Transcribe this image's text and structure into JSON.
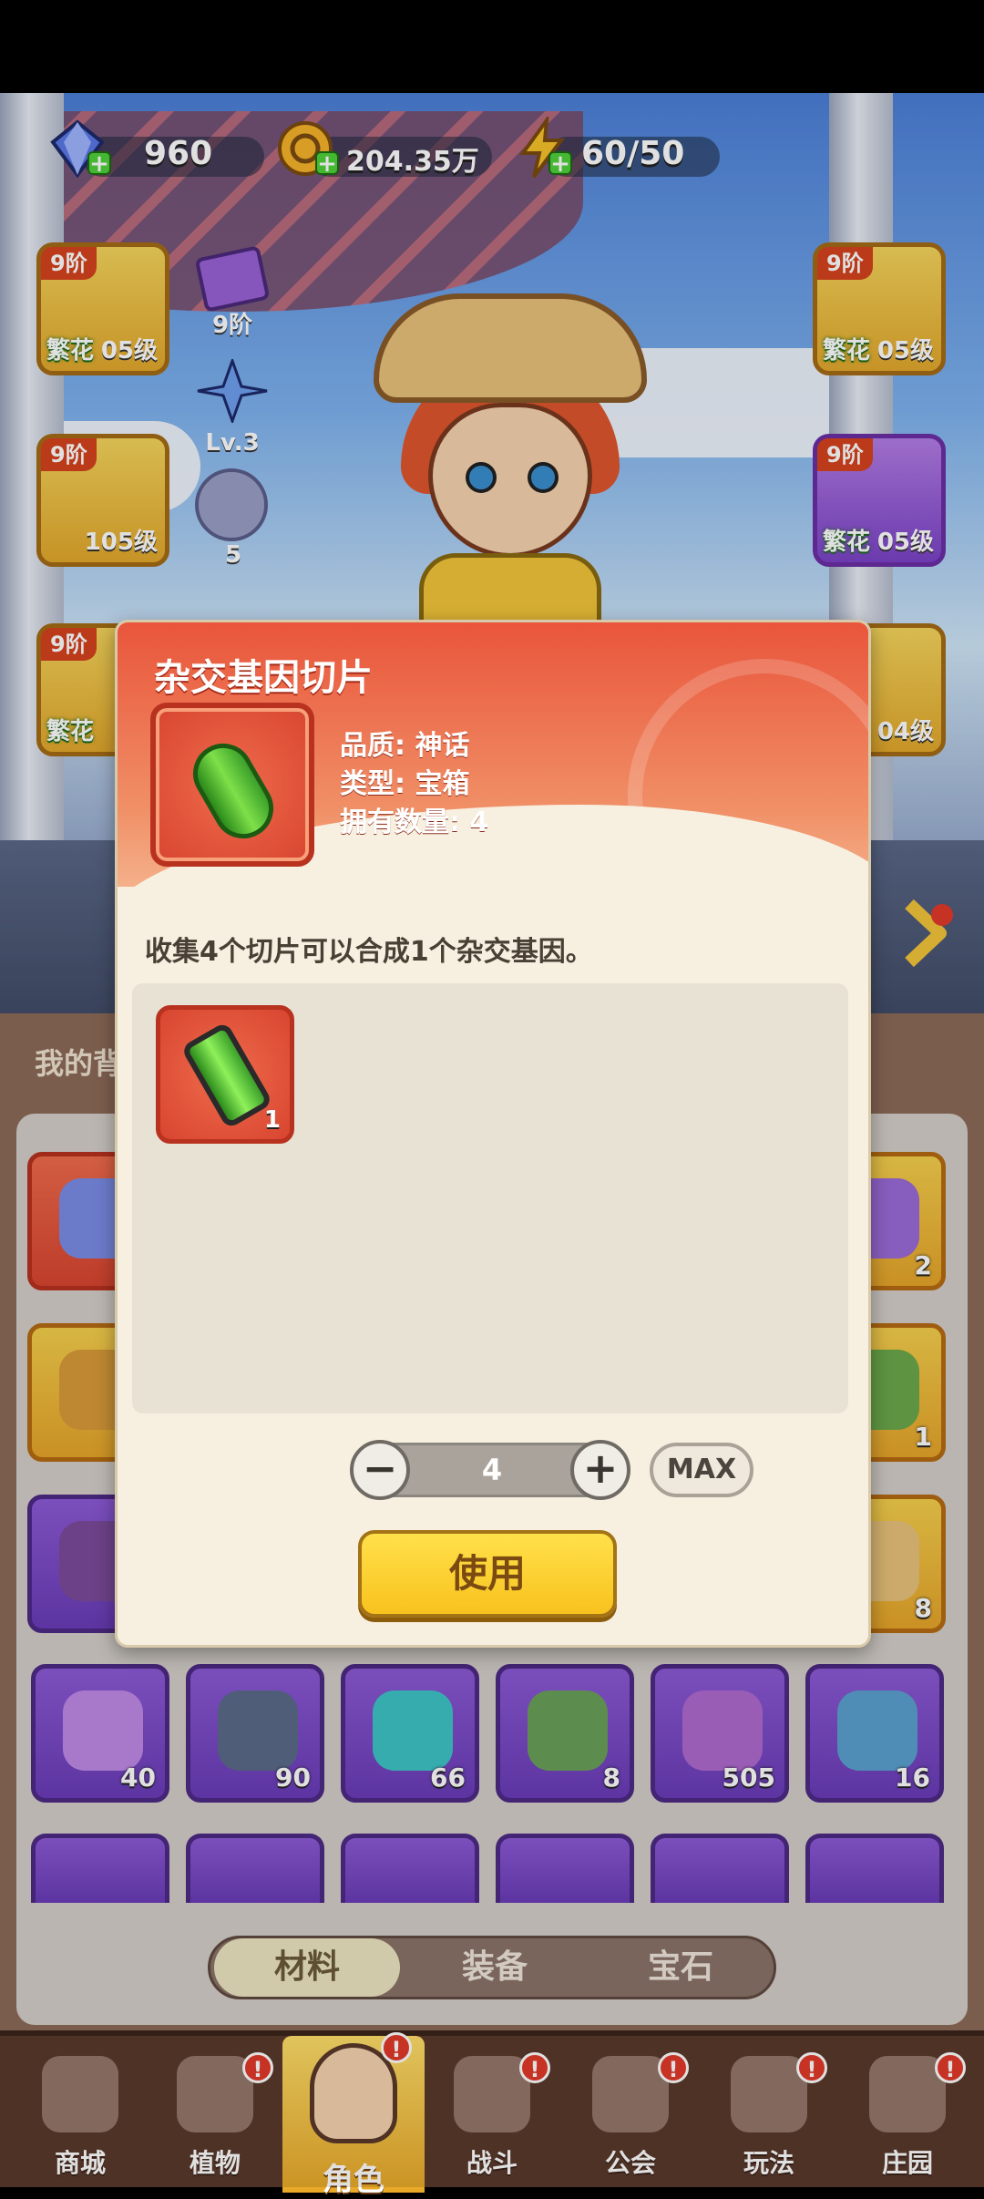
{
  "resources": {
    "gems": "960",
    "coins": "204.35万",
    "energy": "60/50"
  },
  "equipment": {
    "left": [
      {
        "tier": "9阶",
        "tag": "繁花",
        "level": "05级"
      },
      {
        "tier": "9阶",
        "tag": "",
        "level": "105级"
      },
      {
        "tier": "9阶",
        "tag": "繁花",
        "level": ""
      }
    ],
    "right": [
      {
        "tier": "9阶",
        "tag": "繁花",
        "level": "05级"
      },
      {
        "tier": "9阶",
        "tag": "繁花",
        "level": "05级"
      },
      {
        "tier": "",
        "tag": "",
        "level": "04级"
      }
    ],
    "side_badges": [
      "9阶",
      "Lv.3",
      "5"
    ]
  },
  "bag": {
    "title": "我的背",
    "row3_counts": [
      "40",
      "90",
      "66",
      "8",
      "505",
      "16"
    ],
    "right_col_counts": [
      "2",
      "1",
      "8"
    ]
  },
  "tabs": [
    "材料",
    "装备",
    "宝石"
  ],
  "nav": [
    "商城",
    "植物",
    "角色",
    "战斗",
    "公会",
    "玩法",
    "庄园"
  ],
  "modal": {
    "title": "杂交基因切片",
    "quality": "品质: 神话",
    "type": "类型: 宝箱",
    "owned": "拥有数量: 4",
    "description": "收集4个切片可以合成1个杂交基因。",
    "reward_count": "1",
    "quantity": "4",
    "minus": "−",
    "plus": "+",
    "max_label": "MAX",
    "use_label": "使用"
  }
}
